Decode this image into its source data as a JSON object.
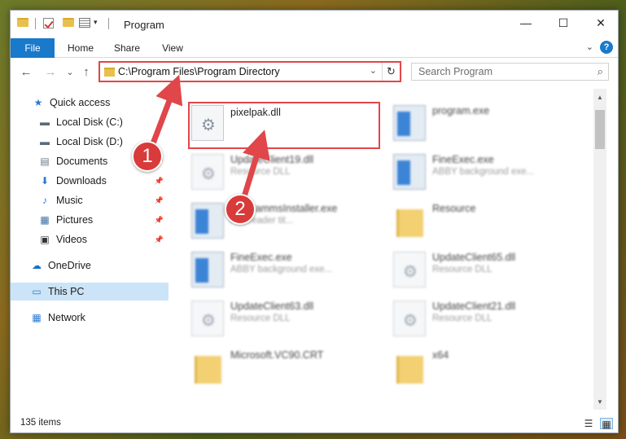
{
  "titlebar": {
    "title": "Program",
    "minimize": "—",
    "maximize": "☐",
    "close": "✕",
    "qa_dropdown": "▾"
  },
  "ribbon": {
    "tabs": [
      "File",
      "Home",
      "Share",
      "View"
    ],
    "help": "?",
    "collapse": "⌄"
  },
  "nav": {
    "back": "←",
    "forward": "→",
    "recent": "⌄",
    "up": "↑"
  },
  "address": {
    "path": "C:\\Program Files\\Program Directory",
    "dropdown": "⌄",
    "refresh": "↻"
  },
  "search": {
    "placeholder": "Search Program",
    "icon": "⌕"
  },
  "sidebar": {
    "items": [
      {
        "label": "Quick access",
        "icon": "★",
        "icon_name": "star-icon",
        "color": "#2b7bd6",
        "pinned": false
      },
      {
        "label": "Local Disk (C:)",
        "icon": "▬",
        "icon_name": "drive-icon",
        "color": "#5a6b7a",
        "pinned": false
      },
      {
        "label": "Local Disk (D:)",
        "icon": "▬",
        "icon_name": "drive-icon",
        "color": "#5a6b7a",
        "pinned": false
      },
      {
        "label": "Documents",
        "icon": "▤",
        "icon_name": "documents-icon",
        "color": "#6a7a8a",
        "pinned": true
      },
      {
        "label": "Downloads",
        "icon": "⬇",
        "icon_name": "download-icon",
        "color": "#2b7bd6",
        "pinned": true
      },
      {
        "label": "Music",
        "icon": "♪",
        "icon_name": "music-icon",
        "color": "#2b7bd6",
        "pinned": true
      },
      {
        "label": "Pictures",
        "icon": "▦",
        "icon_name": "pictures-icon",
        "color": "#3d6fa3",
        "pinned": true
      },
      {
        "label": "Videos",
        "icon": "▣",
        "icon_name": "video-icon",
        "color": "#333333",
        "pinned": true
      },
      {
        "label": "OneDrive",
        "icon": "☁",
        "icon_name": "cloud-icon",
        "color": "#1e6fc6",
        "pinned": false
      },
      {
        "label": "This PC",
        "icon": "▭",
        "icon_name": "computer-icon",
        "color": "#2b7bd6",
        "pinned": false,
        "selected": true
      },
      {
        "label": "Network",
        "icon": "▦",
        "icon_name": "network-icon",
        "color": "#2b7bd6",
        "pinned": false
      }
    ],
    "pin_glyph": "📌"
  },
  "files": [
    {
      "name": "pixelpak.dll",
      "desc": "",
      "type": "dll",
      "highlighted": true,
      "blurred": false
    },
    {
      "name": "program.exe",
      "desc": "",
      "type": "exe",
      "blurred": true
    },
    {
      "name": "UpdateClient19.dll",
      "desc": "Resource DLL",
      "type": "dll",
      "blurred": true
    },
    {
      "name": "FineExec.exe",
      "desc": "ABBY background exe...",
      "type": "exe",
      "blurred": true
    },
    {
      "name": "ProgrammsInstaller.exe",
      "desc": "Finereader tit...",
      "type": "exe",
      "blurred": true
    },
    {
      "name": "Resource",
      "desc": "",
      "type": "folder",
      "blurred": true
    },
    {
      "name": "FineExec.exe",
      "desc": "ABBY background exe...",
      "type": "exe",
      "blurred": true
    },
    {
      "name": "UpdateClient65.dll",
      "desc": "Resource DLL",
      "type": "dll",
      "blurred": true
    },
    {
      "name": "UpdateClient63.dll",
      "desc": "Resource DLL",
      "type": "dll",
      "blurred": true
    },
    {
      "name": "UpdateClient21.dll",
      "desc": "Resource DLL",
      "type": "dll",
      "blurred": true
    },
    {
      "name": "Microsoft.VC90.CRT",
      "desc": "",
      "type": "folder",
      "blurred": true
    },
    {
      "name": "x64",
      "desc": "",
      "type": "folder",
      "blurred": true
    }
  ],
  "status": {
    "count": "135 items",
    "details_view": "☰",
    "tiles_view": "▦"
  },
  "annotations": {
    "badge1": "1",
    "badge2": "2",
    "color": "#e0464a"
  }
}
